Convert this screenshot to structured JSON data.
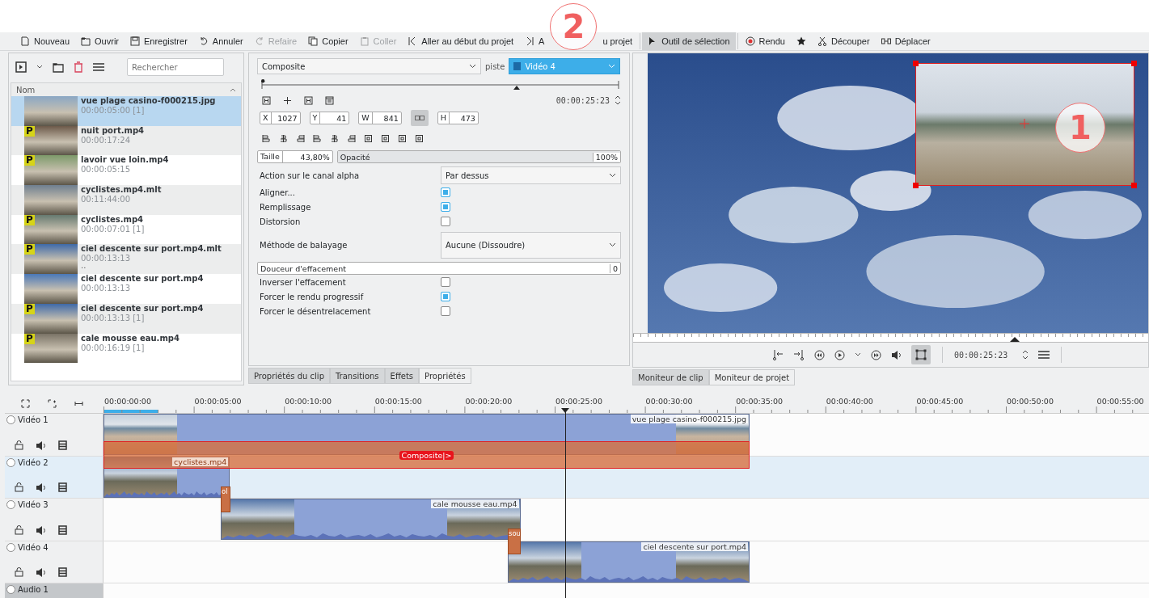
{
  "toolbar": [
    {
      "label": "Nouveau",
      "disabled": false,
      "selected": false
    },
    {
      "label": "Ouvrir",
      "disabled": false,
      "selected": false
    },
    {
      "label": "Enregistrer",
      "disabled": false,
      "selected": false
    },
    {
      "label": "Annuler",
      "disabled": false,
      "selected": false
    },
    {
      "label": "Refaire",
      "disabled": true,
      "selected": false
    },
    {
      "label": "Copier",
      "disabled": false,
      "selected": false
    },
    {
      "label": "Coller",
      "disabled": true,
      "selected": false
    },
    {
      "label": "Aller au début du projet",
      "disabled": false,
      "selected": false
    },
    {
      "label": "A",
      "disabled": false,
      "selected": false
    },
    {
      "label": "u projet",
      "disabled": false,
      "selected": false
    },
    {
      "label": "Outil de sélection",
      "disabled": false,
      "selected": true
    },
    {
      "label": "Rendu",
      "disabled": false,
      "selected": false
    },
    {
      "disabled": false,
      "selected": false
    },
    {
      "label": "Découper",
      "disabled": false,
      "selected": false
    },
    {
      "label": "Déplacer",
      "disabled": false,
      "selected": false
    }
  ],
  "callouts": [
    {
      "number": "2"
    },
    {
      "number": "1"
    }
  ],
  "bin": {
    "search": {
      "placeholder": "Rechercher"
    },
    "column": "Nom",
    "clips": [
      {
        "name": "vue plage casino-f000215.jpg",
        "duration": "00:00:05:00 [1]",
        "selected": true
      },
      {
        "name": "nuit port.mp4",
        "duration": "00:00:17:24",
        "badge": "P",
        "selected": false
      },
      {
        "name": "lavoir vue loin.mp4",
        "duration": "00:00:05:15",
        "badge": "P",
        "selected": false
      },
      {
        "name": "cyclistes.mp4.mlt",
        "duration": "00:11:44:00",
        "selected": false
      },
      {
        "name": "cyclistes.mp4",
        "duration": "00:00:07:01 [1]",
        "badge": "P",
        "selected": false
      },
      {
        "name": "ciel descente sur port.mp4.mlt",
        "duration": "00:00:13:13",
        "extra": "..",
        "badge": "P",
        "selected": false
      },
      {
        "name": "ciel descente sur port.mp4",
        "duration": "00:00:13:13",
        "selected": false
      },
      {
        "name": "ciel descente sur port.mp4",
        "duration": "00:00:13:13 [1]",
        "badge": "P",
        "selected": false
      },
      {
        "name": "cale mousse eau.mp4",
        "duration": "00:00:16:19 [1]",
        "badge": "P",
        "selected": false
      }
    ]
  },
  "properties": {
    "effect": "Composite",
    "track_label": "piste",
    "track": "Vidéo 4",
    "timecode": "00:00:25:23",
    "geometry": [
      {
        "label": "X",
        "value": "1027"
      },
      {
        "label": "Y",
        "value": "41"
      },
      {
        "label": "W",
        "value": "841"
      },
      {
        "label": "H",
        "value": "473"
      }
    ],
    "size": {
      "label": "Taille",
      "value": "43,80%"
    },
    "opacity": {
      "label": "Opacité",
      "value": "100%",
      "level": 1
    },
    "rows": [
      {
        "kind": "select",
        "label": "Action sur le canal alpha",
        "value": "Par dessus"
      },
      {
        "kind": "checkbox",
        "label": "Aligner...",
        "checked": true
      },
      {
        "kind": "checkbox",
        "label": "Remplissage",
        "checked": true
      },
      {
        "kind": "checkbox",
        "label": "Distorsion",
        "checked": false
      },
      {
        "kind": "select",
        "label": "Méthode de balayage",
        "value": "Aucune (Dissoudre)"
      },
      {
        "kind": "slider",
        "label": "Douceur d'effacement",
        "value": "0",
        "level": 0
      },
      {
        "kind": "checkbox",
        "label": "Inverser l'effacement",
        "checked": false
      },
      {
        "kind": "checkbox",
        "label": "Forcer le rendu progressif",
        "checked": true
      },
      {
        "kind": "checkbox",
        "label": "Forcer le désentrelacement",
        "checked": false
      }
    ]
  },
  "panel_tabs": [
    {
      "label": "Propriétés du clip",
      "selected": false
    },
    {
      "label": "Transitions",
      "selected": false
    },
    {
      "label": "Effets",
      "selected": false
    },
    {
      "label": "Propriétés",
      "selected": true
    }
  ],
  "monitor": {
    "timecode": "00:00:25:23",
    "tabs": [
      {
        "label": "Moniteur de clip",
        "selected": false
      },
      {
        "label": "Moniteur de projet",
        "selected": true
      }
    ]
  },
  "timeline": {
    "ruler": [
      "00:00:00:00",
      "00:00:05:00",
      "00:00:10:00",
      "00:00:15:00",
      "00:00:20:00",
      "00:00:25:00",
      "00:00:30:00",
      "00:00:35:00",
      "00:00:40:00",
      "00:00:45:00",
      "00:00:50:00",
      "00:00:55:00"
    ],
    "tracks": [
      {
        "name": "Vidéo 1",
        "kind": "video",
        "selected": false
      },
      {
        "name": "Vidéo 2",
        "kind": "video",
        "selected": true
      },
      {
        "name": "Vidéo 3",
        "kind": "video",
        "selected": false
      },
      {
        "name": "Vidéo 4",
        "kind": "video",
        "selected": false
      },
      {
        "name": "Audio 1",
        "kind": "audio",
        "selected": false
      }
    ],
    "clips": [
      {
        "label": "vue plage casino-f000215.jpg",
        "kind": "image"
      },
      {
        "label": "cyclistes.mp4",
        "kind": "video"
      },
      {
        "label": "cale mousse eau.mp4",
        "kind": "video"
      },
      {
        "label": "ciel descente sur port.mp4",
        "kind": "video"
      }
    ],
    "composite": {
      "label": "Composite|>"
    },
    "dissolves": [
      {
        "label": "ol"
      },
      {
        "label": "sou"
      }
    ]
  }
}
